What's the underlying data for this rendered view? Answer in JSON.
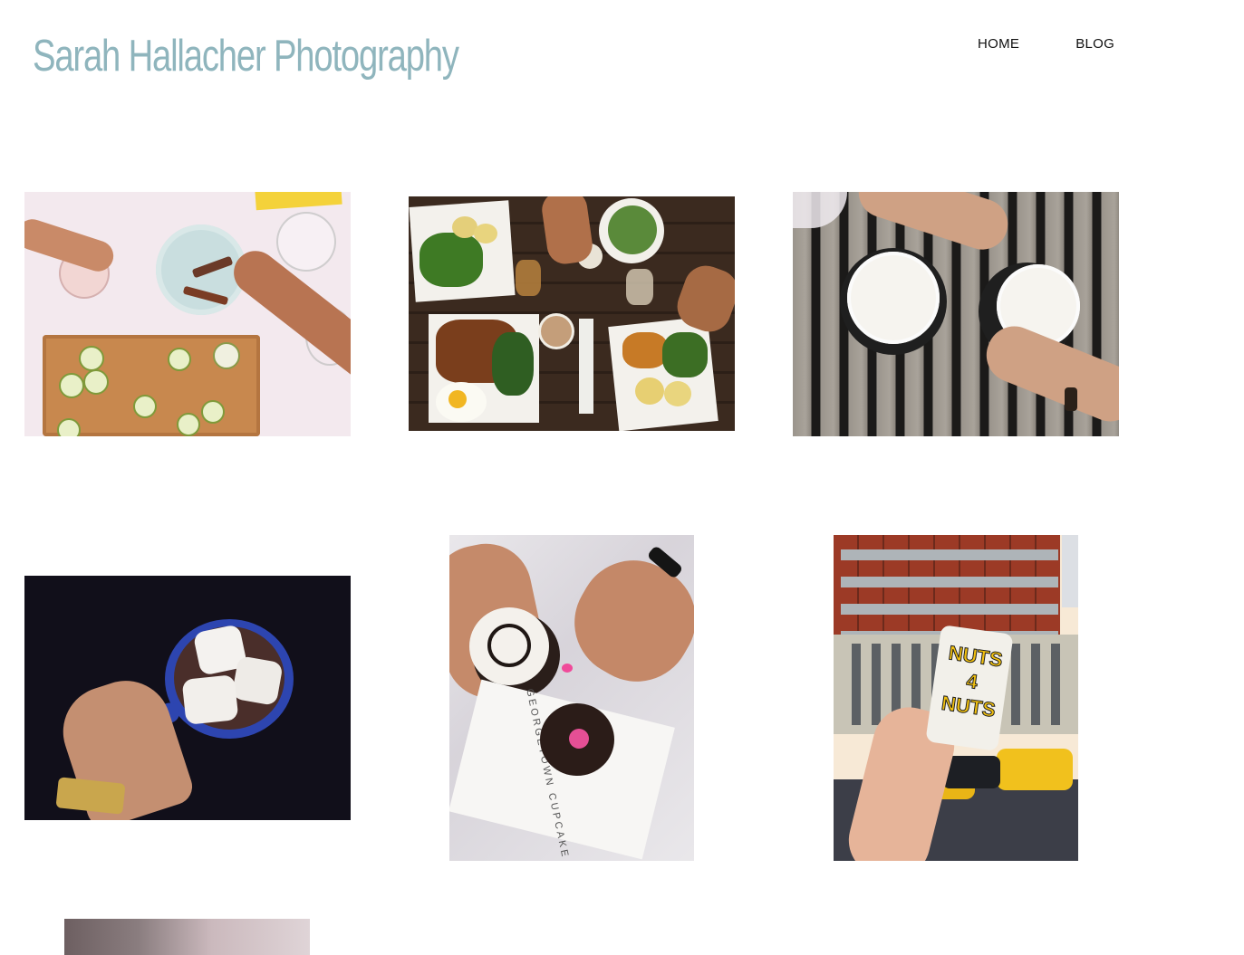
{
  "header": {
    "site_title": "Sarah Hallacher Photography"
  },
  "nav": {
    "items": [
      {
        "label": "HOME"
      },
      {
        "label": "BLOG"
      }
    ]
  },
  "photos": [
    {
      "text": ""
    },
    {
      "text": ""
    },
    {
      "text": ""
    },
    {
      "text": ""
    },
    {
      "text": "GEORGETOWN CUPCAKE"
    },
    {
      "text": "NUTS 4 NUTS"
    },
    {
      "text": ""
    }
  ]
}
